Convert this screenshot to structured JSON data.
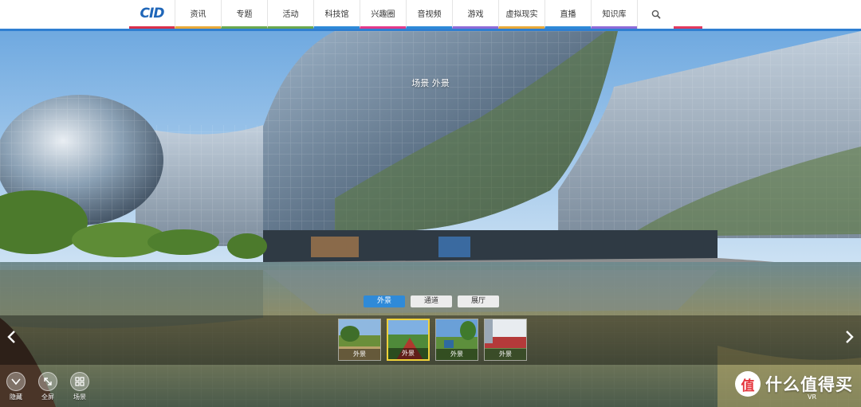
{
  "nav": {
    "logo_text": "CID",
    "items": [
      {
        "label": "资讯",
        "color": "#e8a93a"
      },
      {
        "label": "专题",
        "color": "#6aa84f"
      },
      {
        "label": "活动",
        "color": "#6aa84f"
      },
      {
        "label": "科技馆",
        "color": "#2f8ad8"
      },
      {
        "label": "兴趣圈",
        "color": "#e23a8a"
      },
      {
        "label": "音视频",
        "color": "#2f8ad8"
      },
      {
        "label": "游戏",
        "color": "#8e6ad8"
      },
      {
        "label": "虚拟现实",
        "color": "#e8a93a"
      },
      {
        "label": "直播",
        "color": "#2f8ad8"
      },
      {
        "label": "知识库",
        "color": "#8e6ad8"
      }
    ],
    "search_icon": "search-icon",
    "accent": "#2f7fd1"
  },
  "scene": {
    "title": "场景 外景"
  },
  "group_tabs": [
    {
      "label": "外景",
      "active": true
    },
    {
      "label": "通道",
      "active": false
    },
    {
      "label": "展厅",
      "active": false
    }
  ],
  "thumbnails": [
    {
      "caption": "外景",
      "active": false
    },
    {
      "caption": "外景",
      "active": true
    },
    {
      "caption": "外景",
      "active": false
    },
    {
      "caption": "外景",
      "active": false
    }
  ],
  "controls": [
    {
      "label": "隐藏",
      "icon": "hide-icon"
    },
    {
      "label": "全屏",
      "icon": "fullscreen-icon"
    },
    {
      "label": "场景",
      "icon": "scenes-icon"
    }
  ],
  "brand": {
    "text": "什么值得买",
    "badge_glyph": "值",
    "vr_label": "VR"
  }
}
